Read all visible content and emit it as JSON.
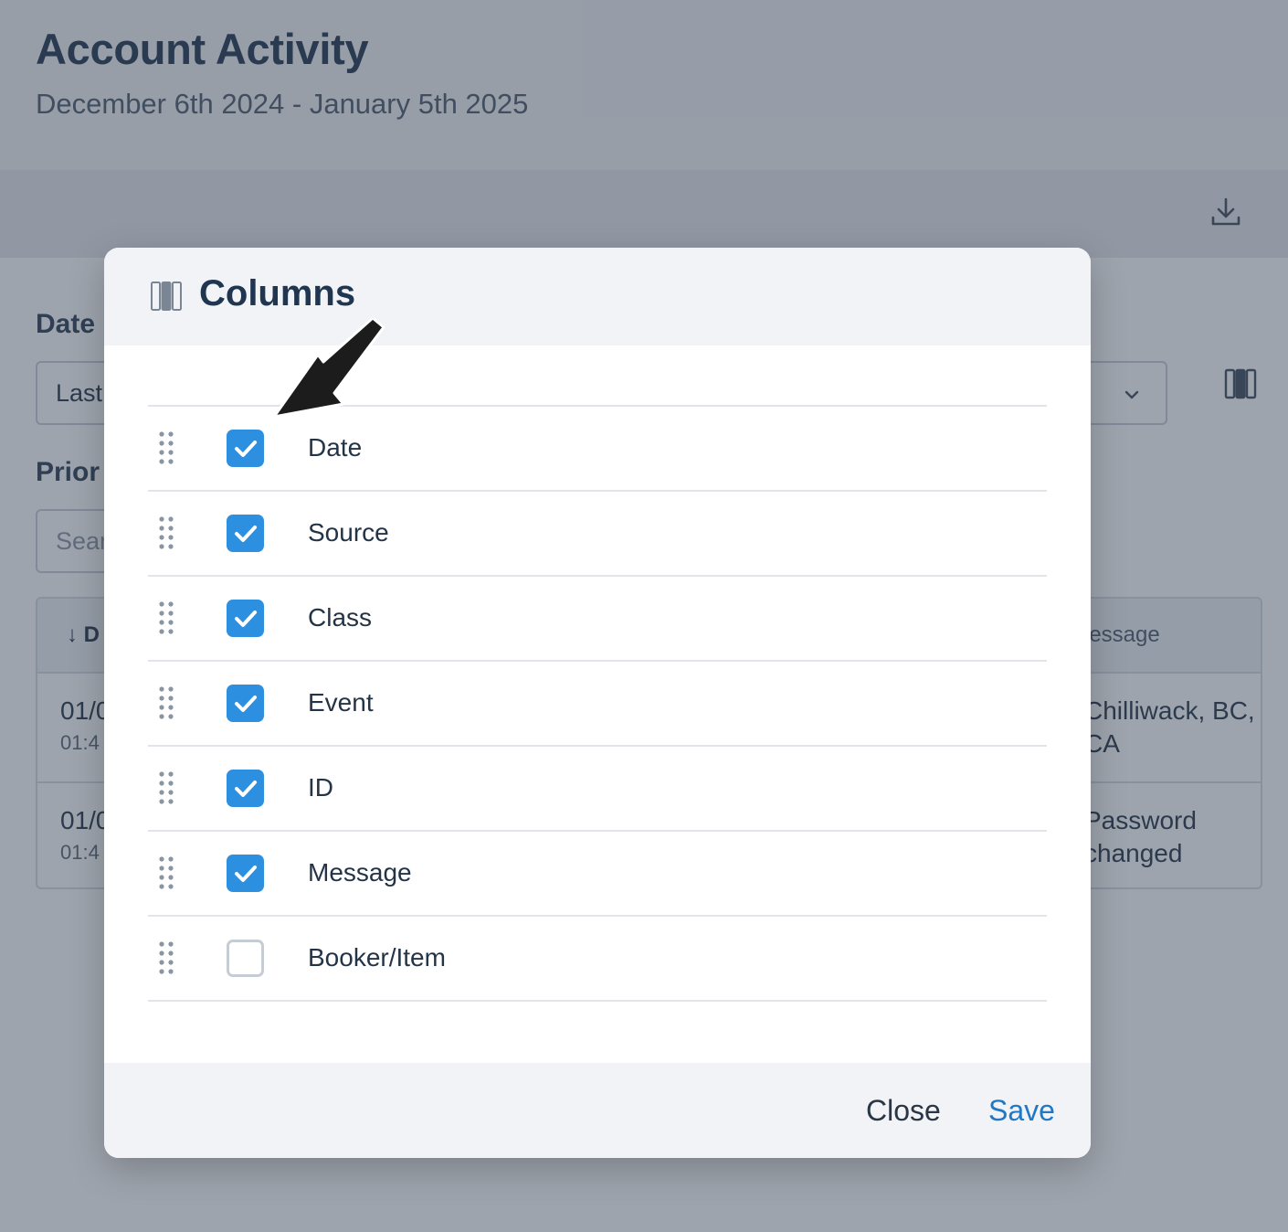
{
  "page": {
    "title": "Account Activity",
    "date_range": "December 6th 2024 - January 5th 2025",
    "filters": {
      "date_label": "Date",
      "date_select_value": "Last",
      "priority_label": "Prior",
      "search_placeholder": "Sear"
    },
    "table": {
      "header_date": "↓ D",
      "header_message": "lessage",
      "rows": [
        {
          "date": "01/0",
          "time": "01:4",
          "message": "Chilliwack, BC, CA"
        },
        {
          "date": "01/0",
          "time": "01:4",
          "message": "Password changed"
        }
      ]
    }
  },
  "modal": {
    "title": "Columns",
    "columns": [
      {
        "label": "Date",
        "checked": true
      },
      {
        "label": "Source",
        "checked": true
      },
      {
        "label": "Class",
        "checked": true
      },
      {
        "label": "Event",
        "checked": true
      },
      {
        "label": "ID",
        "checked": true
      },
      {
        "label": "Message",
        "checked": true
      },
      {
        "label": "Booker/Item",
        "checked": false
      }
    ],
    "close_label": "Close",
    "save_label": "Save"
  },
  "colors": {
    "accent": "#2d8fe0",
    "save_link": "#2178c4",
    "title_text": "#1f3550",
    "overlay": "rgba(52,64,84,0.48)"
  },
  "icons": {
    "download": "download-icon",
    "columns": "columns-icon",
    "drag": "drag-handle-icon",
    "check": "check-icon",
    "chevron": "chevron-down-icon",
    "annotation": "arrow-pointer-icon"
  }
}
